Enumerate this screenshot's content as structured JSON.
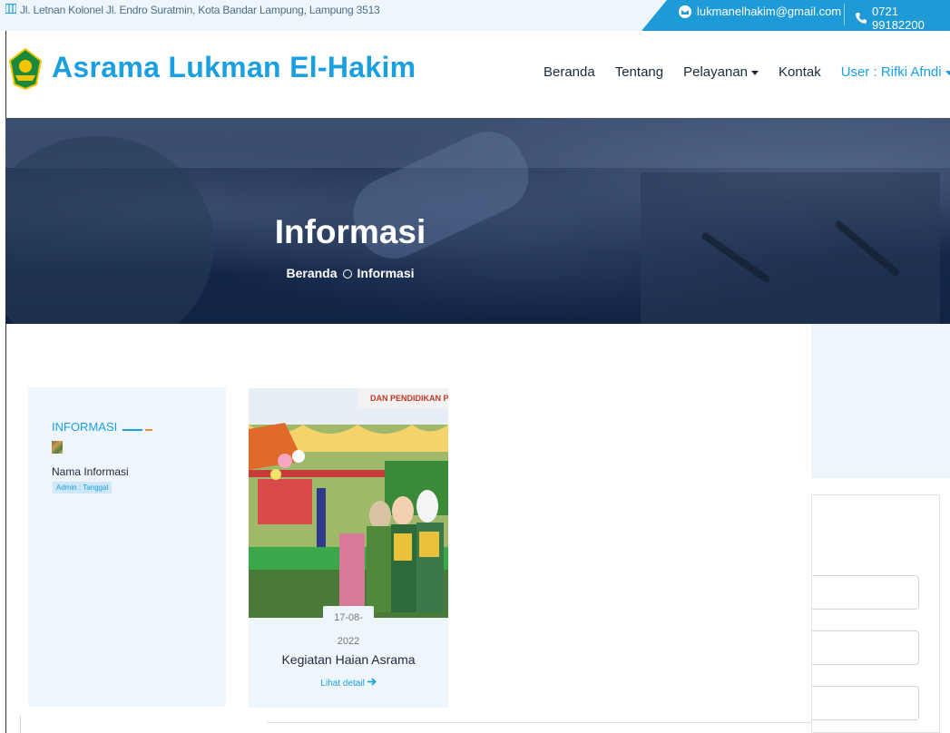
{
  "topbar": {
    "address": "Jl. Letnan Kolonel Jl. Endro Suratmin, Kota Bandar Lampung, Lampung 3513",
    "email": "lukmanelhakim@gmail.com",
    "phone": "0721 99182200"
  },
  "header": {
    "brand": "Asrama Lukman El-Hakim",
    "nav": {
      "home": "Beranda",
      "about": "Tentang",
      "services": "Pelayanan",
      "contact": "Kontak",
      "user": "User : Rifki Afndi"
    }
  },
  "hero": {
    "title": "Informasi",
    "breadcrumb_home": "Beranda",
    "breadcrumb_current": "Informasi"
  },
  "sidebar": {
    "title": "INFORMASI",
    "item_name": "Nama Informasi",
    "item_meta": "Admin : Tanggal"
  },
  "card": {
    "date": "17-08-2022",
    "title": "Kegiatan Haian Asrama",
    "more": "Lihat detail",
    "banner_text": "DAN PENDIDIKAN PON"
  },
  "colors": {
    "accent": "#1a9fe0",
    "dark": "#1b2a3a",
    "light_bg": "#eef6fc",
    "orange": "#f28c28"
  }
}
